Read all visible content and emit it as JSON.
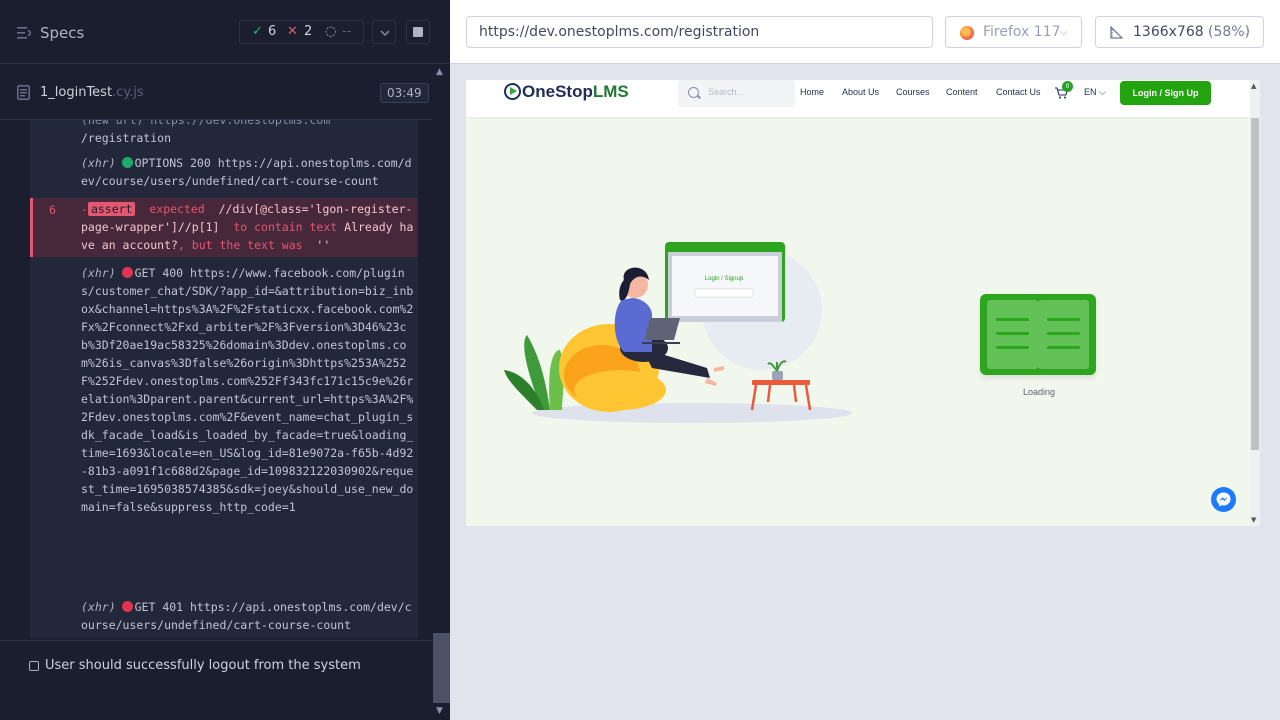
{
  "runner": {
    "specs_label": "Specs",
    "stats": {
      "passed": "6",
      "failed": "2",
      "pending": "--"
    }
  },
  "spec_file": {
    "name": "1_loginTest",
    "ext": ".cy.js",
    "duration": "03:49"
  },
  "command_log": {
    "url_tail": "/registration",
    "url_cutoff": "(new url) https://dev.onestoplms.com",
    "xhr1": {
      "type": "(xhr)",
      "text": "OPTIONS 200 https://api.onestoplms.com/dev/course/users/undefined/cart-course-count"
    },
    "assert": {
      "number": "6",
      "badge": "assert",
      "word_expected": "expected",
      "selector": "//div[@class='lgon-register-page-wrapper']//p[1]",
      "to_contain": "to contain text",
      "expected_text": "Already have an account?",
      "but": ", but the text was",
      "actual": "''"
    },
    "xhr2": {
      "type": "(xhr)",
      "text": "GET 400 https://www.facebook.com/plugins/customer_chat/SDK/?app_id=&attribution=biz_inbox&channel=https%3A%2F%2Fstaticxx.facebook.com%2Fx%2Fconnect%2Fxd_arbiter%2F%3Fversion%3D46%23cb%3Df20ae19ac58325%26domain%3Ddev.onestoplms.com%26is_canvas%3Dfalse%26origin%3Dhttps%253A%252F%252Fdev.onestoplms.com%252Ff343fc171c15c9e%26relation%3Dparent.parent&current_url=https%3A%2F%2Fdev.onestoplms.com%2F&event_name=chat_plugin_sdk_facade_load&is_loaded_by_facade=true&loading_time=1693&locale=en_US&log_id=81e9072a-f65b-4d92-81b3-a091f1c688d2&page_id=109832122030902&request_time=1695038574385&sdk=joey&should_use_new_domain=false&suppress_http_code=1"
    },
    "xhr3": {
      "type": "(xhr)",
      "text": "GET 401 https://api.onestoplms.com/dev/course/users/undefined/cart-course-count"
    }
  },
  "next_test": "User should successfully logout from the system",
  "browser_bar": {
    "url": "https://dev.onestoplms.com/registration",
    "browser": "Firefox 117",
    "viewport": "1366x768",
    "zoom": "(58%)"
  },
  "aut": {
    "logo_prefix": "One",
    "logo_mid": "Stop",
    "logo_suffix": "LMS",
    "search_placeholder": "Search...",
    "nav": [
      "Home",
      "About Us",
      "Courses",
      "Content",
      "Contact Us"
    ],
    "cart_count": "0",
    "language": "EN",
    "login_button": "Login / Sign Up",
    "illustration_title": "Login / Signup",
    "loading_text": "Loading"
  },
  "colors": {
    "brand_green": "#22a310",
    "pass": "#2fb77a",
    "fail": "#e45770",
    "runner_bg": "#1b1e2e"
  }
}
